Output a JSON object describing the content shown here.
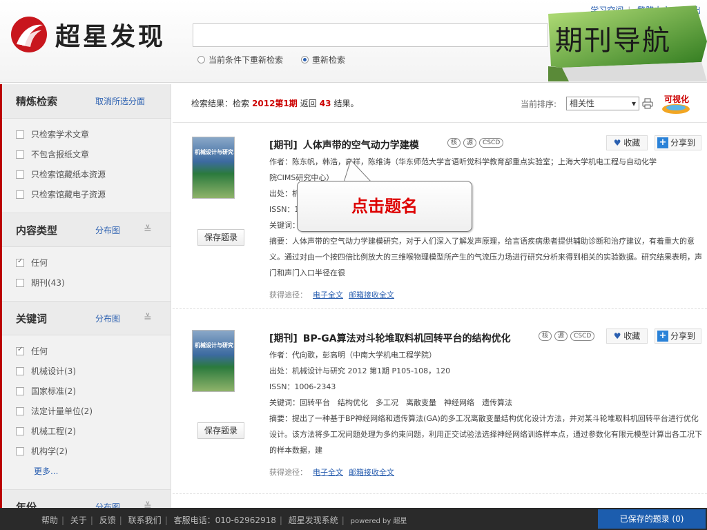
{
  "header": {
    "logo_text": "超星发现",
    "search_value": "",
    "radio_options": [
      {
        "label": "当前条件下重新检索",
        "checked": false
      },
      {
        "label": "重新检索",
        "checked": true
      }
    ],
    "top_links": [
      "学习空间",
      "繁體中文",
      "退出"
    ]
  },
  "banner": {
    "text": "期刊导航"
  },
  "sidebar": {
    "refine": {
      "title": "精炼检索",
      "action": "取消所选分面",
      "items": [
        {
          "label": "只检索学术文章",
          "checked": false
        },
        {
          "label": "不包含报纸文章",
          "checked": false
        },
        {
          "label": "只检索馆藏纸本资源",
          "checked": false
        },
        {
          "label": "只检索馆藏电子资源",
          "checked": false
        }
      ]
    },
    "content_type": {
      "title": "内容类型",
      "action": "分布图",
      "items": [
        {
          "label": "任何",
          "checked": true
        },
        {
          "label": "期刊(43)",
          "checked": false
        }
      ]
    },
    "keywords": {
      "title": "关键词",
      "action": "分布图",
      "items": [
        {
          "label": "任何",
          "checked": true
        },
        {
          "label": "机械设计(3)",
          "checked": false
        },
        {
          "label": "国家标准(2)",
          "checked": false
        },
        {
          "label": "法定计量单位(2)",
          "checked": false
        },
        {
          "label": "机械工程(2)",
          "checked": false
        },
        {
          "label": "机构学(2)",
          "checked": false
        }
      ],
      "more": "更多..."
    },
    "year": {
      "title": "年份",
      "action": "分布图"
    }
  },
  "results": {
    "prefix": "检索结果：检索",
    "query": "2012第1期",
    "mid": "返回",
    "count": "43",
    "suffix": "结果。",
    "sort_label": "当前排序:",
    "sort_value": "相关性",
    "viz_label": "可视化"
  },
  "records": [
    {
      "cover_title": "机械设计与研究",
      "save": "保存题录",
      "tag": "[期刊]",
      "title": "人体声带的空气动力学建模",
      "badges": [
        "核",
        "源",
        "CSCD"
      ],
      "fav": "收藏",
      "share": "分享到",
      "author": "作者：陈东帆，韩浩，高祥，陈维涛（华东师范大学言语听觉科学教育部重点实验室；上海大学机电工程与自动化学",
      "author2": "院CIMS研究中心）",
      "source": "出处：机",
      "issn": "ISSN：1",
      "keywords": "关键词：",
      "abstract": "摘要：人体声带的空气动力学建模研究，对于人们深入了解发声原理，给言语疾病患者提供辅助诊断和治疗建议，有着重大的意义。通过对由一个按四倍比例放大的三维喉物理模型所产生的气流压力场进行研究分析来得到相关的实验数据。研究结果表明，声门和声门入口半径在很",
      "access_label": "获得途径：",
      "link1": "电子全文",
      "link2": "邮箱接收全文"
    },
    {
      "cover_title": "机械设计与研究",
      "save": "保存题录",
      "tag": "[期刊]",
      "title": "BP-GA算法对斗轮堆取料机回转平台的结构优化",
      "badges": [
        "核",
        "源",
        "CSCD"
      ],
      "fav": "收藏",
      "share": "分享到",
      "author": "作者：代向歌，彭高明（中南大学机电工程学院）",
      "source": "出处：机械设计与研究 2012 第1期 P105-108，120",
      "issn": "ISSN：1006-2343",
      "keywords": "关键词：回转平台　结构优化　多工况　离散变量　神经网络　遗传算法",
      "abstract": "摘要：提出了一种基于BP神经网络和遗传算法(GA)的多工况离散变量结构优化设计方法，并对某斗轮堆取料机回转平台进行优化设计。该方法将多工况问题处理为多约束问题，利用正交试验法选择神经网络训练样本点，通过参数化有限元模型计算出各工况下的样本数据，建",
      "access_label": "获得途径：",
      "link1": "电子全文",
      "link2": "邮箱接收全文"
    }
  ],
  "callout": {
    "text": "点击题名"
  },
  "footer": {
    "links": [
      "帮助",
      "关于",
      "反馈",
      "联系我们",
      "客服电话：010-62962918",
      "超星发现系统",
      "powered by 超星"
    ],
    "saved": "已保存的题录 (0)"
  },
  "colors": {
    "accent": "#2a5fb0",
    "highlight": "#cc0000",
    "brand_red": "#b00000"
  }
}
